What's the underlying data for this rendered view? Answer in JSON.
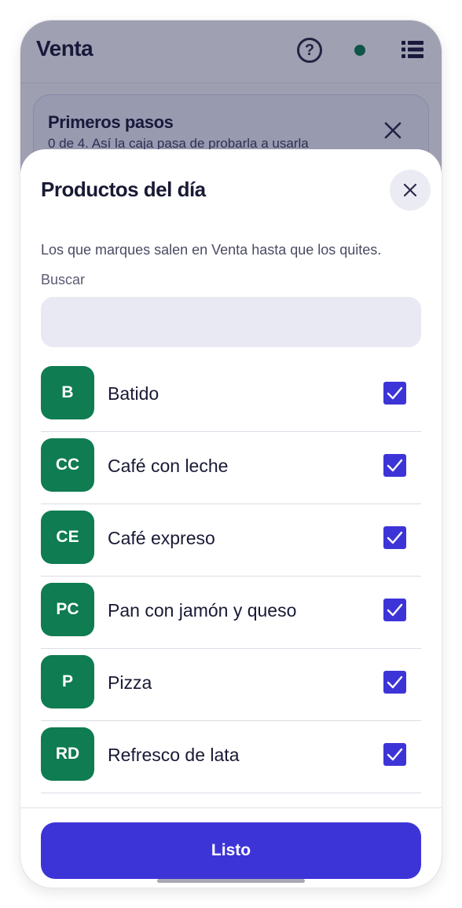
{
  "app": {
    "title": "Venta",
    "help_glyph": "?",
    "status_color": "#0f7a52"
  },
  "onboarding": {
    "title": "Primeros pasos",
    "subtitle": "0 de 4. Así la caja pasa de probarla a usarla"
  },
  "sheet": {
    "title": "Productos del día",
    "description": "Los que marques salen en Venta hasta que los quites.",
    "search_label": "Buscar",
    "search_value": "",
    "items": [
      {
        "initials": "B",
        "name": "Batido",
        "checked": true
      },
      {
        "initials": "CC",
        "name": "Café con leche",
        "checked": true
      },
      {
        "initials": "CE",
        "name": "Café expreso",
        "checked": true
      },
      {
        "initials": "PC",
        "name": "Pan con jamón y queso",
        "checked": true
      },
      {
        "initials": "P",
        "name": "Pizza",
        "checked": true
      },
      {
        "initials": "RD",
        "name": "Refresco de lata",
        "checked": true
      }
    ],
    "done_label": "Listo"
  },
  "colors": {
    "accent": "#3d34d8",
    "avatar": "#0f7c52",
    "text": "#181934"
  },
  "icons": {
    "help": "question-circle-icon",
    "status": "online-dot-icon",
    "menu": "list-menu-icon",
    "close": "close-icon",
    "check": "checkmark-icon"
  }
}
